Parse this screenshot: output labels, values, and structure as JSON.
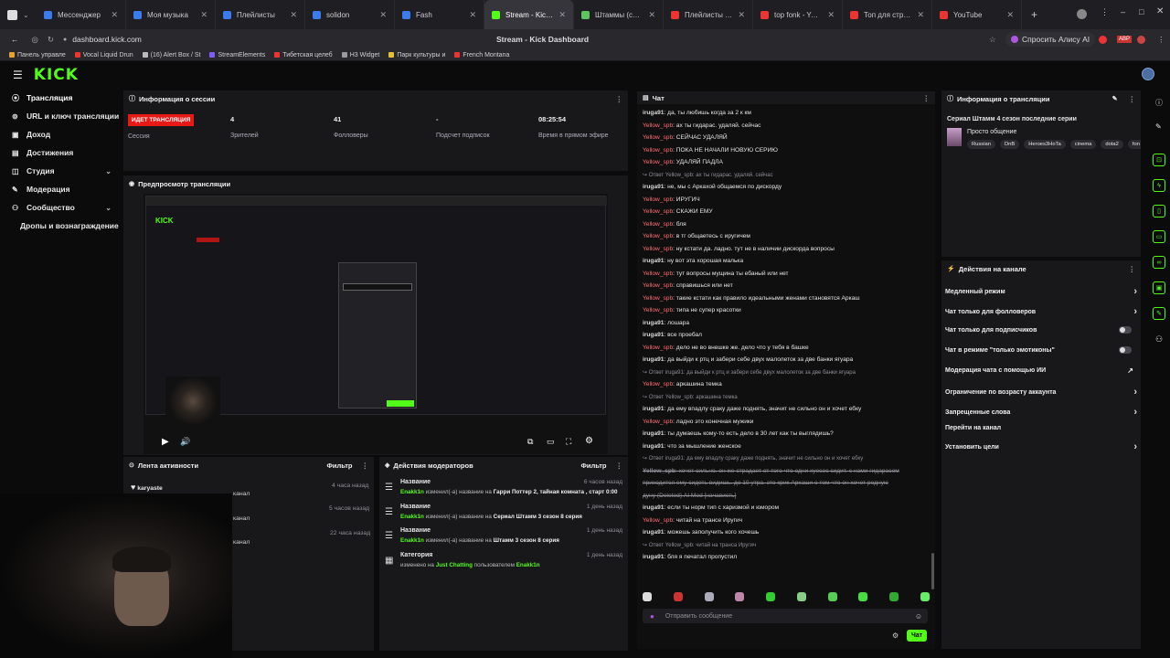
{
  "browser": {
    "tabs": [
      {
        "label": "Мессенджер",
        "color": "#3b7bf0"
      },
      {
        "label": "Моя музыка",
        "color": "#3b7bf0"
      },
      {
        "label": "Плейлисты",
        "color": "#3b7bf0"
      },
      {
        "label": "solidon",
        "color": "#3b7bf0"
      },
      {
        "label": "Fash",
        "color": "#3b7bf0"
      },
      {
        "label": "Stream - Kick Dashboard",
        "color": "#53fc18"
      },
      {
        "label": "Штаммы (сериал, 1, 2, 3, 4",
        "color": "#5ec45e"
      },
      {
        "label": "Плейлисты - YouTube",
        "color": "#e33"
      },
      {
        "label": "top fonk - YouTube",
        "color": "#e33"
      },
      {
        "label": "Топ для стрима - YouTub",
        "color": "#e33"
      },
      {
        "label": "YouTube",
        "color": "#e33"
      }
    ],
    "url": "dashboard.kick.com",
    "page_title": "Stream - Kick Dashboard",
    "alice_label": "Спросить Алису AI",
    "bookmarks": [
      {
        "label": "Панель управле",
        "color": "#e5a12b"
      },
      {
        "label": "Vocal Liquid Drun",
        "color": "#e33"
      },
      {
        "label": "(16) Alert Box / St",
        "color": "#bbb"
      },
      {
        "label": "StreamElements",
        "color": "#7b5cff"
      },
      {
        "label": "Тибетская целеб",
        "color": "#e33"
      },
      {
        "label": "H3 Widget",
        "color": "#9a9aa1"
      },
      {
        "label": "Парк культуры и",
        "color": "#e5c12b"
      },
      {
        "label": "French Montana",
        "color": "#e33"
      }
    ]
  },
  "colors": {
    "accent": "#53fc18",
    "live": "#e91916",
    "panel": "#18181b"
  },
  "kick": {
    "logo": "KICK"
  },
  "sidebar": {
    "items": [
      {
        "label": "Трансляция",
        "icon": "broadcast-icon",
        "glyph": "⦿"
      },
      {
        "label": "URL и ключ трансляции",
        "icon": "link-icon",
        "glyph": "⊚"
      },
      {
        "label": "Доход",
        "icon": "money-icon",
        "glyph": "▣"
      },
      {
        "label": "Достижения",
        "icon": "trophy-icon",
        "glyph": "▤"
      },
      {
        "label": "Студия",
        "icon": "studio-icon",
        "glyph": "◫"
      },
      {
        "label": "Модерация",
        "icon": "wrench-icon",
        "glyph": "✎"
      },
      {
        "label": "Сообщество",
        "icon": "community-icon",
        "glyph": "⚇"
      },
      {
        "label": "Дропы и вознаграждение",
        "icon": "",
        "glyph": ""
      }
    ]
  },
  "session": {
    "title": "Информация о сессии",
    "live_badge": "ИДЕТ ТРАНСЛЯЦИЯ",
    "session_label": "Сессия",
    "stats": [
      {
        "value": "4",
        "label": "Зрителей"
      },
      {
        "value": "41",
        "label": "Фолловеры"
      },
      {
        "value": "-",
        "label": "Подсчет подписок"
      },
      {
        "value": "08:25:54",
        "label": "Время в прямом эфире"
      }
    ]
  },
  "preview": {
    "title": "Предпросмотр трансляции"
  },
  "activity": {
    "title": "Лента активности",
    "filter": "Фильтр",
    "items": [
      {
        "name": "karyaste",
        "action": "",
        "time": "4 часа назад"
      },
      {
        "name": "",
        "action": "канал",
        "time": "5 часов назад"
      },
      {
        "name": "",
        "action": "канал",
        "time": "22 часа назад"
      },
      {
        "name": "",
        "action": "канал",
        "time": ""
      }
    ]
  },
  "modactions": {
    "title": "Действия модераторов",
    "filter": "Фильтр",
    "items": [
      {
        "type": "Название",
        "user": "Enakk1n",
        "text": "изменил(-а) название на",
        "value": "Гарри Поттер 2, тайная комната , старт 0:00",
        "time": "6 часов назад"
      },
      {
        "type": "Название",
        "user": "Enakk1n",
        "text": "изменил(-а) название на",
        "value": "Сериал Штамм 3 сезон 8 серия",
        "time": "1 день назад"
      },
      {
        "type": "Название",
        "user": "Enakk1n",
        "text": "изменил(-а) название на",
        "value": "Штамм 3 сезон 8 серия",
        "time": "1 день назад"
      },
      {
        "type": "Категория",
        "user": "Enakk1n",
        "text": "изменено на",
        "value": "Just Chatting",
        "suffix": "пользователем",
        "time": "1 день назад"
      }
    ]
  },
  "chat": {
    "title": "Чат",
    "placeholder": "Отправить сообщение",
    "send": "Чат",
    "messages": [
      {
        "u": "iruga91",
        "t": ": да, ты любишь когда за 2 к км",
        "k": "u2"
      },
      {
        "u": "Yellow_spb",
        "t": ": ах ты гидарас. удаляй. сейчас",
        "k": "u1"
      },
      {
        "u": "Yellow_spb",
        "t": ": СЕЙЧАС УДАЛЯЙ",
        "k": "u1"
      },
      {
        "u": "Yellow_spb",
        "t": ": ПОКА НЕ НАЧАЛИ НОВУЮ СЕРИЮ",
        "k": "u1"
      },
      {
        "u": "Yellow_spb",
        "t": ": УДАЛЯЙ ПАДЛА",
        "k": "u1"
      },
      {
        "u": "",
        "t": "↪ Ответ Yellow_spb: ах ты гидарас. удаляй. сейчас",
        "k": "reply"
      },
      {
        "u": "iruga91",
        "t": ": не, мы с Аркахой общаемся по дискорду",
        "k": "u2"
      },
      {
        "u": "Yellow_spb",
        "t": ": ИРУГИЧ",
        "k": "u1"
      },
      {
        "u": "Yellow_spb",
        "t": ": СКАЖИ ЕМУ",
        "k": "u1"
      },
      {
        "u": "Yellow_spb",
        "t": ": бля",
        "k": "u1"
      },
      {
        "u": "Yellow_spb",
        "t": ": в тг общаетесь с иругичем",
        "k": "u1"
      },
      {
        "u": "Yellow_spb",
        "t": ": ну кстати да. ладно. тут не в наличии дискорда вопросы",
        "k": "u1"
      },
      {
        "u": "iruga91",
        "t": ": ну вот эта хорошая малька",
        "k": "u2"
      },
      {
        "u": "Yellow_spb",
        "t": ": тут вопросы мущина ты ебаный или нет",
        "k": "u1"
      },
      {
        "u": "Yellow_spb",
        "t": ": справишься или нет",
        "k": "u1"
      },
      {
        "u": "Yellow_spb",
        "t": ": такие кстати как правило идеальными женами становятся Аркаш",
        "k": "u1"
      },
      {
        "u": "Yellow_spb",
        "t": ": типа не супер красотки",
        "k": "u1"
      },
      {
        "u": "iruga91",
        "t": ": лошара",
        "k": "u2"
      },
      {
        "u": "iruga91",
        "t": ": все проебал",
        "k": "u2"
      },
      {
        "u": "Yellow_spb",
        "t": ": дело не во внешке же. дело что у тебя в башке",
        "k": "u1"
      },
      {
        "u": "iruga91",
        "t": ": да выйди к ртц и забери себе двух малолеток за две банки ягуара",
        "k": "u2"
      },
      {
        "u": "",
        "t": "↪ Ответ iruga91: да выйди к ртц и забери себе двух малолеток за две банки ягуара",
        "k": "reply"
      },
      {
        "u": "Yellow_spb",
        "t": ": аркашина темка",
        "k": "u1"
      },
      {
        "u": "",
        "t": "↪ Ответ Yellow_spb: аркашина темка",
        "k": "reply"
      },
      {
        "u": "iruga91",
        "t": ": да ему впадлу сраку даже поднять, значит не сильно он и хочет ебку",
        "k": "u2"
      },
      {
        "u": "Yellow_spb",
        "t": ": ладно это конечная мужики",
        "k": "u1"
      },
      {
        "u": "iruga91",
        "t": ": ты думаешь кому-то есть дело в 30 лет как ты выглядишь?",
        "k": "u2"
      },
      {
        "u": "iruga91",
        "t": ": что за мышление женское",
        "k": "u2"
      },
      {
        "u": "",
        "t": "↪ Ответ iruga91: да ему впадлу сраку даже поднять, значит не сильно он и хочет ебку",
        "k": "reply"
      },
      {
        "u": "Yellow_spb",
        "t": ": хочет сильно. он же страдает от того что одни хуесос сидит. с нами гидарасом",
        "k": "strike"
      },
      {
        "u": "",
        "t": "приходится ему сидеть видишь. до 10 утра. это крик Аркаши о том что он хочет родную",
        "k": "strike"
      },
      {
        "u": "",
        "t": "дуну (Deleted) AI Mod [начависть]",
        "k": "strike"
      },
      {
        "u": "iruga91",
        "t": ": если ты норм тип с харизмой и юмором",
        "k": "u2"
      },
      {
        "u": "Yellow_spb",
        "t": ": читай на трансе Иругич",
        "k": "u1"
      },
      {
        "u": "iruga91",
        "t": ": можешь заполучить кого хочешь",
        "k": "u2"
      },
      {
        "u": "",
        "t": "↪ Ответ Yellow_spb: читай на транса Иругич",
        "k": "reply"
      },
      {
        "u": "iruga91",
        "t": ": бля я печатал пропустил",
        "k": "u2"
      }
    ]
  },
  "streaminfo": {
    "title": "Информация о трансляции",
    "stream_title": "Сериал Штамм 4 сезон последние серии",
    "category": "Просто общение",
    "tags": [
      "Russian",
      "DnB",
      "Heroes3HoTa",
      "cinema",
      "dota2",
      "fon"
    ]
  },
  "channel": {
    "title": "Действия на канале",
    "rows": [
      {
        "label": "Медленный режим",
        "ctl": "chev"
      },
      {
        "label": "Чат только для фолловеров",
        "ctl": "chev"
      },
      {
        "label": "Чат только для подписчиков",
        "ctl": "toggle"
      },
      {
        "label": "Чат в режиме \"только эмотиконы\"",
        "ctl": "toggle"
      },
      {
        "label": "Модерация чата с помощью ИИ",
        "ctl": "ext"
      },
      {
        "label": "Ограничение по возрасту аккаунта",
        "ctl": "chev"
      },
      {
        "label": "Запрещенные слова",
        "ctl": "chev"
      },
      {
        "label": "Перейти на канал",
        "ctl": ""
      },
      {
        "label": "Установить цели",
        "ctl": "chev"
      }
    ]
  }
}
